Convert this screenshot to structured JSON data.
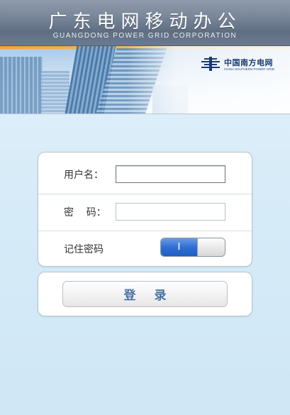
{
  "header": {
    "title": "广东电网移动办公",
    "subtitle": "GUANGDONG POWER GRID CORPORATION"
  },
  "banner": {
    "logo_cn": "中国南方电网",
    "logo_en": "CHINA SOUTHERN POWER GRID"
  },
  "form": {
    "username_label": "用户名：",
    "username_value": "",
    "password_label": "密    码：",
    "password_value": "",
    "remember_label": "记住密码",
    "remember_toggle_text": "I",
    "remember_on": true
  },
  "login": {
    "button_label": "登录"
  },
  "colors": {
    "header_bg": "#7a889a",
    "toggle_on": "#2f6fd3",
    "login_text": "#4a6fa0"
  }
}
